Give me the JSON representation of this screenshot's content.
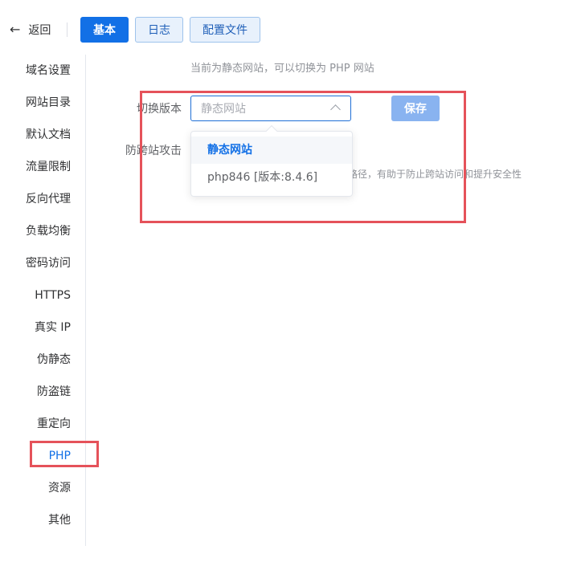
{
  "header": {
    "back_label": "返回",
    "tabs": [
      {
        "label": "基本",
        "active": true
      },
      {
        "label": "日志",
        "active": false
      },
      {
        "label": "配置文件",
        "active": false
      }
    ]
  },
  "sidebar": {
    "items": [
      {
        "label": "域名设置"
      },
      {
        "label": "网站目录"
      },
      {
        "label": "默认文档"
      },
      {
        "label": "流量限制"
      },
      {
        "label": "反向代理"
      },
      {
        "label": "负载均衡"
      },
      {
        "label": "密码访问"
      },
      {
        "label": "HTTPS"
      },
      {
        "label": "真实 IP"
      },
      {
        "label": "伪静态"
      },
      {
        "label": "防盗链"
      },
      {
        "label": "重定向"
      },
      {
        "label": "PHP",
        "active": true
      },
      {
        "label": "资源"
      },
      {
        "label": "其他"
      }
    ]
  },
  "main": {
    "hint": "当前为静态网站，可以切换为 PHP 网站",
    "switch_label": "切换版本",
    "select_placeholder": "静态网站",
    "save_label": "保存",
    "anti_label": "防跨站攻击",
    "helper_text": "路径，有助于防止跨站访问和提升安全性",
    "dropdown_options": [
      {
        "label": "静态网站",
        "selected": true
      },
      {
        "label": "php846 [版本:8.4.6]",
        "selected": false
      }
    ]
  },
  "colors": {
    "accent": "#1270e6",
    "highlight_box": "#e5525a",
    "save_disabled": "#89b3f0"
  }
}
